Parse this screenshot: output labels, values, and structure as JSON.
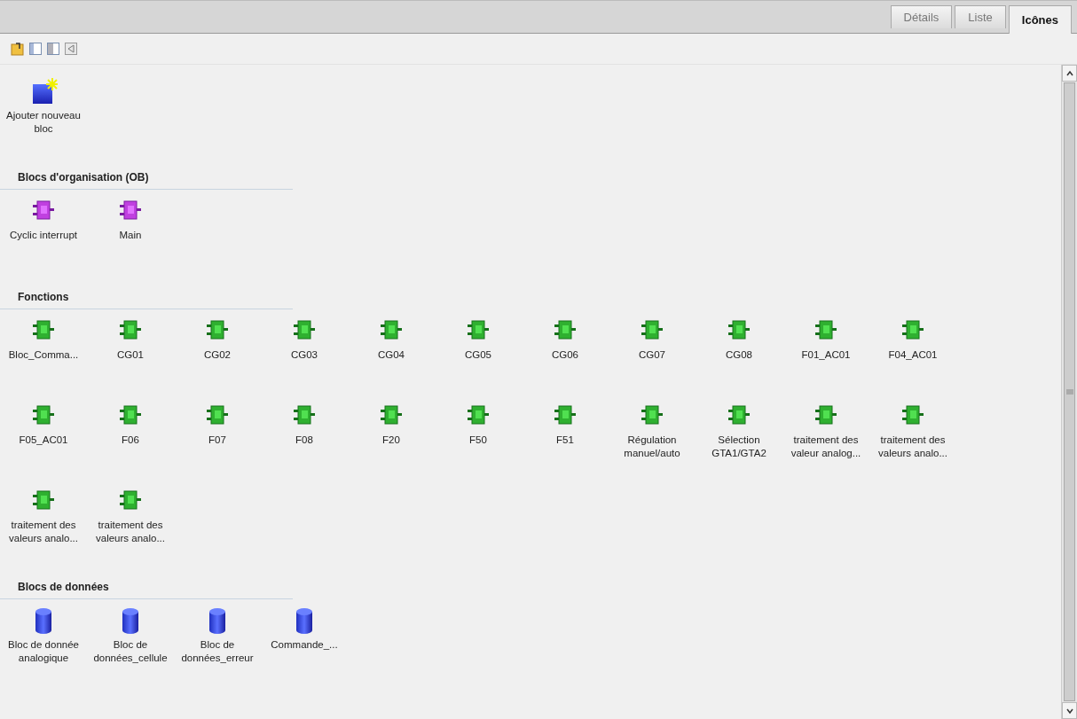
{
  "tabs": [
    {
      "label": "Détails",
      "selected": false
    },
    {
      "label": "Liste",
      "selected": false
    },
    {
      "label": "Icônes",
      "selected": true
    }
  ],
  "toolbar": [
    {
      "kind": "folder"
    },
    {
      "kind": "left-pane"
    },
    {
      "kind": "right-pane"
    },
    {
      "kind": "print"
    }
  ],
  "new_block": {
    "label": "Ajouter nouveau bloc"
  },
  "sections": [
    {
      "title": "Blocs d'organisation (OB)",
      "kind": "ob",
      "items": [
        "Cyclic interrupt",
        "Main"
      ]
    },
    {
      "title": "Fonctions",
      "kind": "fc",
      "items": [
        "Bloc_Comma...",
        "CG01",
        "CG02",
        "CG03",
        "CG04",
        "CG05",
        "CG06",
        "CG07",
        "CG08",
        "F01_AC01",
        "F04_AC01",
        "F05_AC01",
        "F06",
        "F07",
        "F08",
        "F20",
        "F50",
        "F51",
        "Régulation manuel/auto",
        "Sélection GTA1/GTA2",
        "traitement des valeur analog...",
        "traitement des valeurs analo...",
        "traitement des valeurs analo...",
        "traitement des valeurs analo..."
      ]
    },
    {
      "title": "Blocs de données",
      "kind": "db",
      "items": [
        "Bloc de donnée analogique",
        "Bloc de données_cellule",
        "Bloc de données_erreur",
        "Commande_..."
      ]
    }
  ]
}
